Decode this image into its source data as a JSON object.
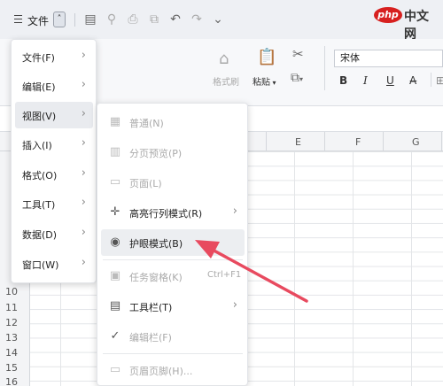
{
  "quickbar": {
    "file_label": "文件",
    "chevron": "˄"
  },
  "watermark": {
    "php": "php",
    "cn": "中文网"
  },
  "ribbon": {
    "format_painter": "格式刷",
    "paste": "粘贴",
    "font_name": "宋体",
    "bold": "B",
    "italic": "I",
    "underline": "U",
    "strike": "A̶"
  },
  "columns": [
    "E",
    "F",
    "G"
  ],
  "rows": [
    "10",
    "11",
    "12",
    "13",
    "14",
    "15",
    "16"
  ],
  "menu1": {
    "items": [
      {
        "label": "文件(F)"
      },
      {
        "label": "编辑(E)"
      },
      {
        "label": "视图(V)"
      },
      {
        "label": "插入(I)"
      },
      {
        "label": "格式(O)"
      },
      {
        "label": "工具(T)"
      },
      {
        "label": "数据(D)"
      },
      {
        "label": "窗口(W)"
      }
    ]
  },
  "menu2": {
    "items": [
      {
        "label": "普通(N)",
        "icon": "grid-icon"
      },
      {
        "label": "分页预览(P)",
        "icon": "page-break-icon"
      },
      {
        "label": "页面(L)",
        "icon": "page-icon"
      },
      {
        "label": "高亮行列模式(R)",
        "icon": "crosshair-icon"
      },
      {
        "label": "护眼模式(B)",
        "icon": "eye-icon"
      },
      {
        "label": "任务窗格(K)",
        "icon": "pane-icon",
        "shortcut": "Ctrl+F1"
      },
      {
        "label": "工具栏(T)",
        "icon": "toolbar-icon"
      },
      {
        "label": "编辑栏(F)",
        "icon": "check-icon"
      },
      {
        "label": "页眉页脚(H)...",
        "icon": "header-footer-icon"
      }
    ]
  },
  "colors": {
    "arrow": "#e84a5f",
    "highlight": "#eceef1"
  }
}
